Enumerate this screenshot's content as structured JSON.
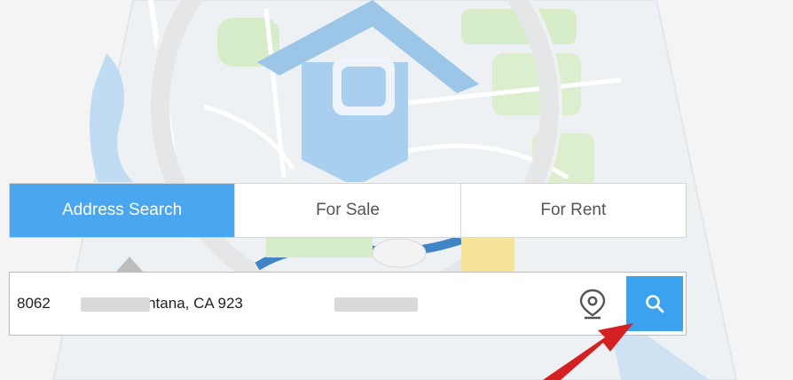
{
  "tabs": [
    {
      "label": "Address Search",
      "active": true
    },
    {
      "label": "For Sale",
      "active": false
    },
    {
      "label": "For Rent",
      "active": false
    }
  ],
  "search": {
    "value": "8062            Ave Fontana, CA 923",
    "locate_icon": "location-pin-icon",
    "button_icon": "search-icon"
  },
  "colors": {
    "accent": "#4aa6ee",
    "search_button": "#3aa2ee",
    "arrow": "#d42020"
  }
}
